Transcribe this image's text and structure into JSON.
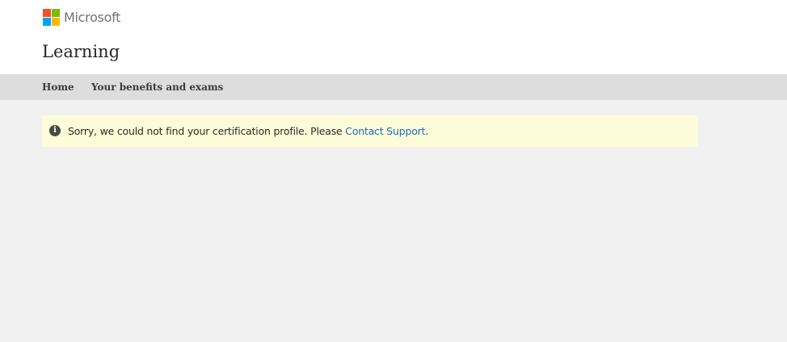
{
  "header": {
    "brand": "Microsoft",
    "site_title": "Learning",
    "logo_colors": [
      "#f25022",
      "#7fba00",
      "#00a4ef",
      "#ffb900"
    ]
  },
  "nav": {
    "items": [
      {
        "label": "Home"
      },
      {
        "label": "Your benefits and exams"
      }
    ]
  },
  "alert": {
    "icon": "info-icon",
    "message": "Sorry, we could not find your certification profile. Please ",
    "link_label": "Contact Support",
    "trailing": "."
  }
}
